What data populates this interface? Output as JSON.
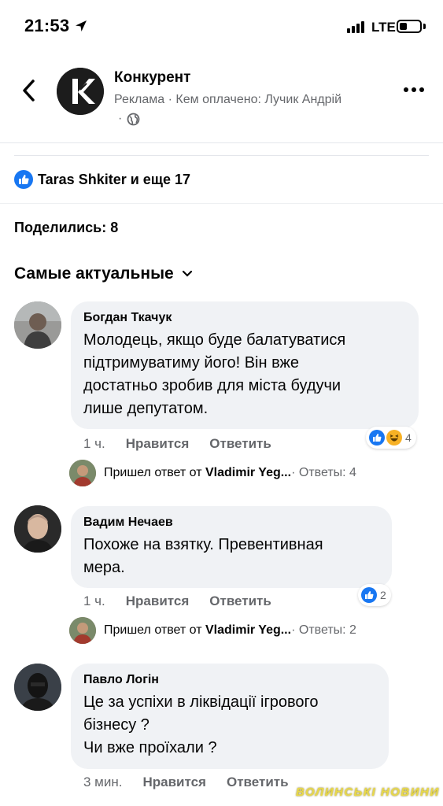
{
  "status": {
    "time": "21:53",
    "network": "LTE",
    "battery_level": 0.3
  },
  "header": {
    "page_name": "Конкурент",
    "ad_line": "Реклама · Кем оплачено: Лучик Андрій",
    "ad_line2": "·",
    "logo_letter": "K"
  },
  "reactions": {
    "summary": "Taras Shkiter и еще 17"
  },
  "shares": "Поделились: 8",
  "sort_label": "Самые актуальные",
  "comments": [
    {
      "author": "Богдан Ткачук",
      "text": "Молодець, якщо буде балатуватися\nпідтримуватиму його! Він вже\nдостатньо зробив для міста будучи\nлише депутатом.",
      "time": "1 ч.",
      "like": "Нравится",
      "reply": "Ответить",
      "reaction_count": "4",
      "reply_prefix": "Пришел ответ от ",
      "reply_name": "Vladimir Yeg...",
      "reply_count": " · Ответы: 4"
    },
    {
      "author": "Вадим Нечаев",
      "text": "Похоже на взятку. Превентивная\nмера.",
      "time": "1 ч.",
      "like": "Нравится",
      "reply": "Ответить",
      "reaction_count": "2",
      "reply_prefix": "Пришел ответ от ",
      "reply_name": "Vladimir Yeg...",
      "reply_count": " · Ответы: 2"
    },
    {
      "author": "Павло Логін",
      "text": "Це за успіхи в ліквідації ігрового\nбізнесу ?\nЧи вже проїхали ?",
      "time": "3 мин.",
      "like": "Нравится",
      "reply": "Ответить"
    }
  ],
  "watermark": "ВОЛИНСЬКІ НОВИНИ",
  "colors": {
    "like_blue": "#1877f2",
    "haha_yellow": "#f7b125",
    "bubble_bg": "#f0f2f5",
    "secondary_text": "#65676b"
  }
}
